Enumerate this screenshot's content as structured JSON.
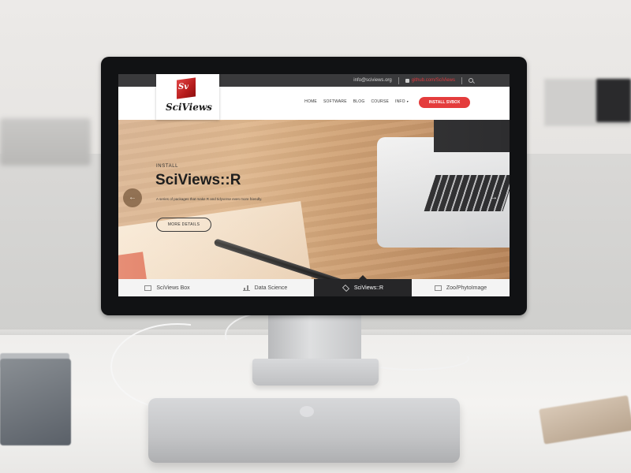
{
  "site": {
    "topbar": {
      "email": "info@sciviews.org",
      "github": "github.com/SciViews",
      "github_icon": "github-icon",
      "search_icon": "search-icon"
    },
    "logo": {
      "mark": "Sv",
      "text": "SciViews"
    },
    "nav": {
      "items": [
        "HOME",
        "SOFTWARE",
        "BLOG",
        "COURSE",
        "INFO"
      ],
      "info_caret": "▾",
      "cta": "INSTALL SVBOX",
      "cta_color": "#e43c3c"
    },
    "hero": {
      "eyebrow": "INSTALL",
      "title": "SciViews::R",
      "subtitle": "A series of packages that make R and tidyverse even more friendly.",
      "button": "MORE DETAILS",
      "prev_icon": "arrow-left-icon",
      "next_icon": "arrow-right-icon"
    },
    "tabs": [
      {
        "label": "SciViews Box",
        "icon": "monitor-icon",
        "active": false
      },
      {
        "label": "Data Science",
        "icon": "bar-chart-icon",
        "active": false
      },
      {
        "label": "SciViews::R",
        "icon": "cube-icon",
        "active": true
      },
      {
        "label": "Zoo/PhytoImage",
        "icon": "screen-icon",
        "active": false
      }
    ]
  },
  "device": {
    "brand_logo": "apple-logo-icon"
  }
}
